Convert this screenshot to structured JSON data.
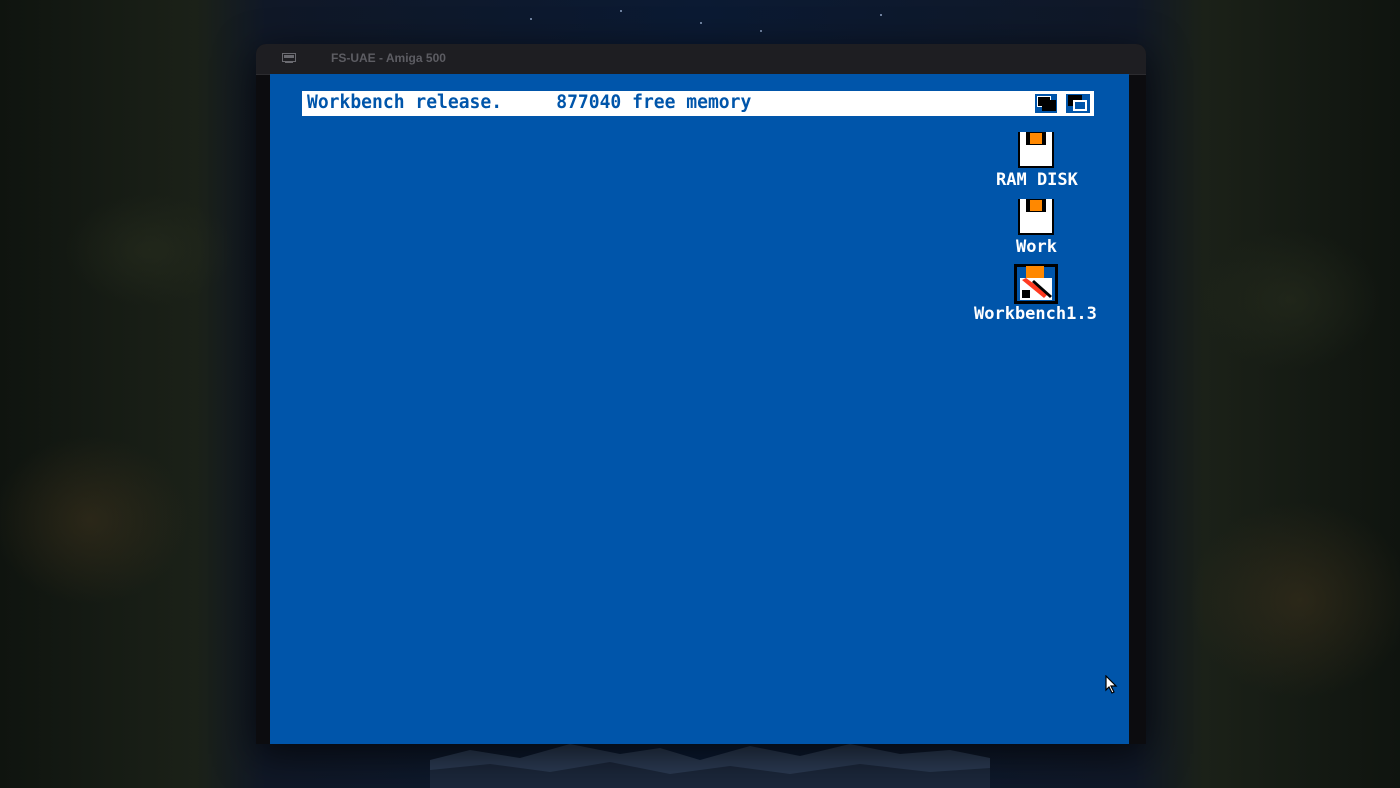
{
  "host_window": {
    "title": "FS-UAE - Amiga 500",
    "icon": "emulator-window-icon"
  },
  "workbench": {
    "title_text": "Workbench release.     877040 free memory",
    "gadgets": [
      "screen-depth-back-icon",
      "screen-depth-front-icon"
    ],
    "colors": {
      "background": "#0055aa",
      "titlebar": "#ffffff",
      "text": "#ffffff",
      "accent": "#ff8800",
      "black": "#000000"
    }
  },
  "icons": [
    {
      "label": "RAM DISK",
      "icon": "ram-disk-icon"
    },
    {
      "label": "Work",
      "icon": "hard-disk-icon"
    },
    {
      "label": "Workbench1.3",
      "icon": "workbench-disk-icon"
    }
  ],
  "pointer": {
    "icon": "mouse-pointer-icon"
  }
}
